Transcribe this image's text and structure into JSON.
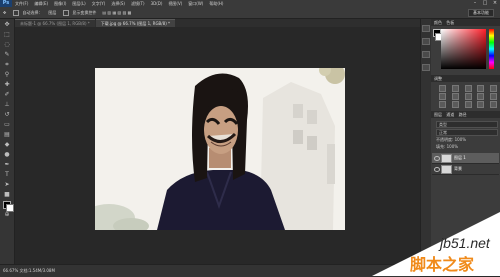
{
  "menubar": {
    "logo": "Ps",
    "items": [
      "文件(F)",
      "编辑(E)",
      "图像(I)",
      "图层(L)",
      "文字(Y)",
      "选择(S)",
      "滤镜(T)",
      "3D(D)",
      "视图(V)",
      "窗口(W)",
      "帮助(H)"
    ],
    "controls": [
      "–",
      "□",
      "×"
    ]
  },
  "options": {
    "auto_select_label": "自动选择：",
    "auto_select_value": "图层",
    "transform_label": "显示变换控件",
    "workspace": "基本功能"
  },
  "document": {
    "tabs": [
      {
        "label": "未标题-1 @ 66.7% (图层 1, RGB/8) *",
        "active": false
      },
      {
        "label": "下载.jpg @ 66.7% (图层 1, RGB/8) *",
        "active": true
      }
    ]
  },
  "status": {
    "text": "66.67%   文档:1.54M/3.08M"
  },
  "panels": {
    "color_tab": "颜色",
    "swatches_tab": "色板",
    "adjustments_tab": "调整",
    "layers_tab": "图层",
    "channels_tab": "通道",
    "paths_tab": "路径",
    "kind_label": "类型",
    "blend_mode": "正常",
    "opacity_label": "不透明度:",
    "opacity_value": "100%",
    "fill_label": "填充:",
    "fill_value": "100%",
    "layers": [
      {
        "name": "图层 1",
        "selected": true
      },
      {
        "name": "背景",
        "selected": false
      }
    ]
  },
  "watermark": {
    "site": "jb51.net",
    "text": "脚本之家"
  }
}
